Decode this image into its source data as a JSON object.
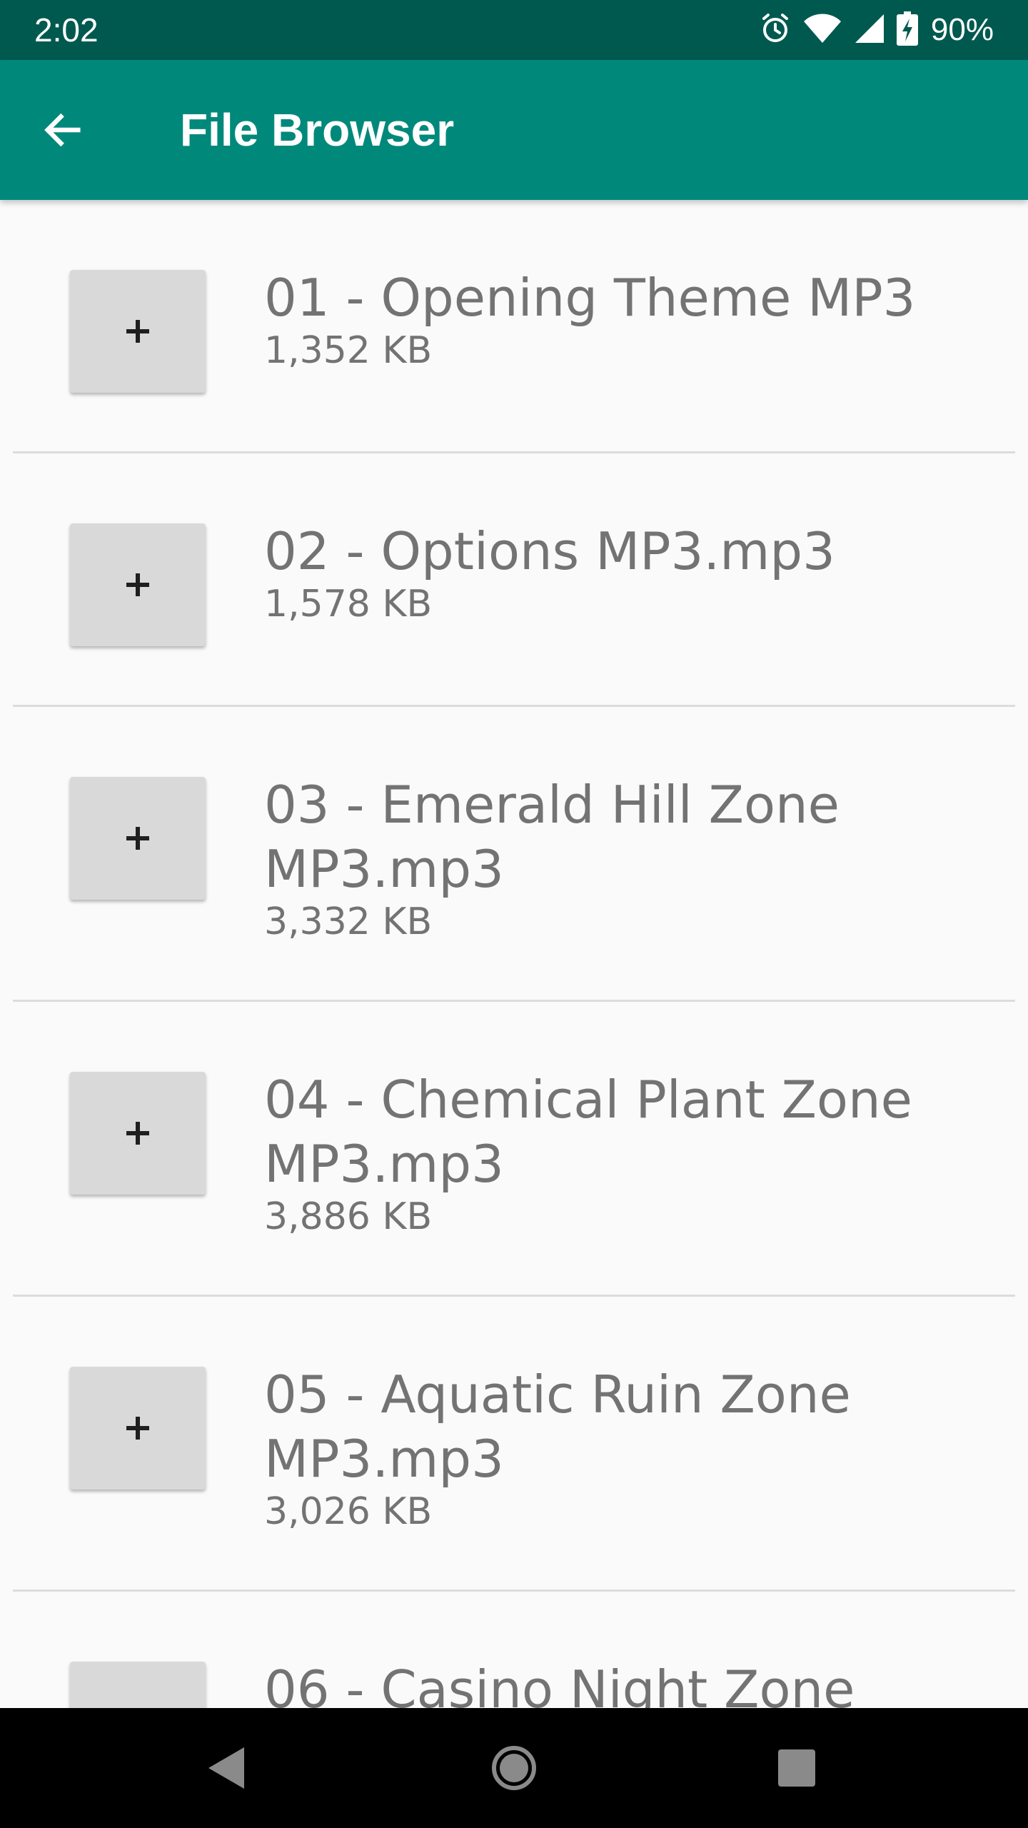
{
  "status_bar": {
    "time": "2:02",
    "battery_percent": "90%",
    "icons": [
      "alarm-icon",
      "wifi-icon",
      "signal-icon",
      "battery-charging-icon"
    ]
  },
  "app_bar": {
    "title": "File Browser",
    "back_icon": "arrow-back-icon"
  },
  "files": [
    {
      "name": "01 - Opening Theme MP3",
      "size": "1,352 KB",
      "button": "+"
    },
    {
      "name": "02 - Options MP3.mp3",
      "size": "1,578 KB",
      "button": "+"
    },
    {
      "name": "03 - Emerald Hill Zone MP3.mp3",
      "size": "3,332 KB",
      "button": "+"
    },
    {
      "name": "04 - Chemical Plant Zone MP3.mp3",
      "size": "3,886 KB",
      "button": "+"
    },
    {
      "name": "05 - Aquatic Ruin Zone MP3.mp3",
      "size": "3,026 KB",
      "button": "+"
    },
    {
      "name": "06 - Casino Night Zone",
      "size": "",
      "button": "+"
    }
  ],
  "nav_bar": {
    "buttons": [
      "back-triangle-icon",
      "home-circle-icon",
      "recents-square-icon"
    ]
  },
  "colors": {
    "status_bar": "#00594f",
    "app_bar": "#00897b",
    "background": "#fafafa",
    "button": "#d9d9d9",
    "text": "#737373"
  }
}
